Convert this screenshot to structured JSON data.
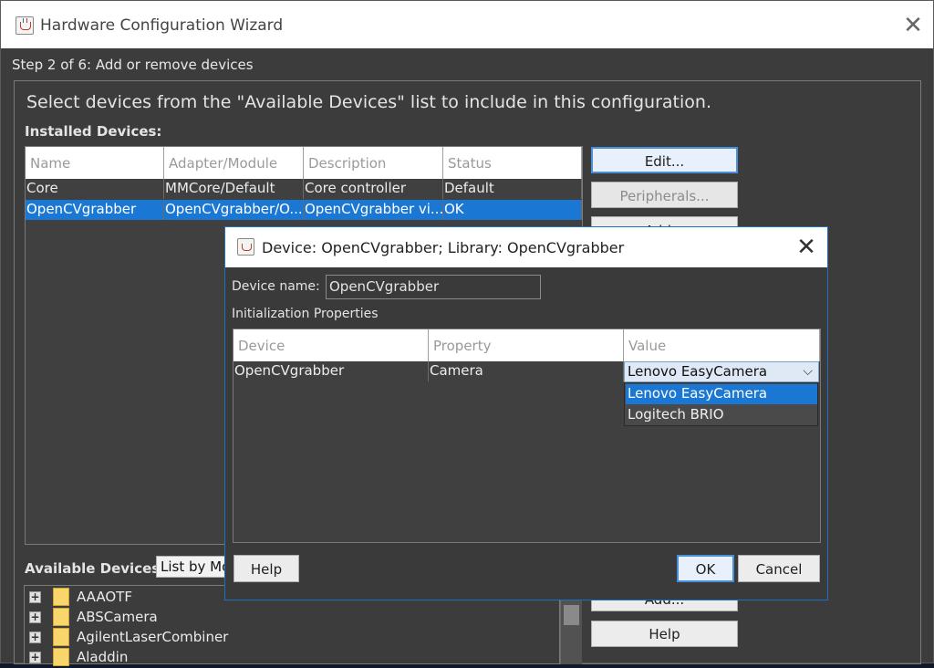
{
  "window": {
    "title": "Hardware Configuration Wizard",
    "step": "Step 2 of 6: Add or remove devices",
    "instruction": "Select devices from the \"Available Devices\" list to include in this configuration."
  },
  "installed": {
    "label": "Installed Devices:",
    "columns": [
      "Name",
      "Adapter/Module",
      "Description",
      "Status"
    ],
    "rows": [
      [
        "Core",
        "MMCore/Default",
        "Core controller",
        "Default"
      ],
      [
        "OpenCVgrabber",
        "OpenCVgrabber/O...",
        "OpenCVgrabber vi...",
        "OK"
      ]
    ],
    "selected_row": 1
  },
  "side_buttons": {
    "edit": "Edit...",
    "peripherals": "Peripherals...",
    "add": "Add...",
    "help": "Help"
  },
  "available": {
    "label": "Available Devices:",
    "list_mode": "List by Module",
    "items": [
      "AAAOTF",
      "ABSCamera",
      "AgilentLaserCombiner",
      "Aladdin"
    ]
  },
  "dialog": {
    "title": "Device: OpenCVgrabber; Library: OpenCVgrabber",
    "device_name_label": "Device name:",
    "device_name_value": "OpenCVgrabber",
    "init_label": "Initialization Properties",
    "columns": [
      "Device",
      "Property",
      "Value"
    ],
    "row": [
      "OpenCVgrabber",
      "Camera",
      "Lenovo EasyCamera"
    ],
    "options": [
      "Lenovo EasyCamera",
      "Logitech BRIO"
    ],
    "selected_option": 0,
    "help": "Help",
    "ok": "OK",
    "cancel": "Cancel"
  },
  "colors": {
    "selection": "#1a78d4",
    "background": "#3c3c3c"
  }
}
